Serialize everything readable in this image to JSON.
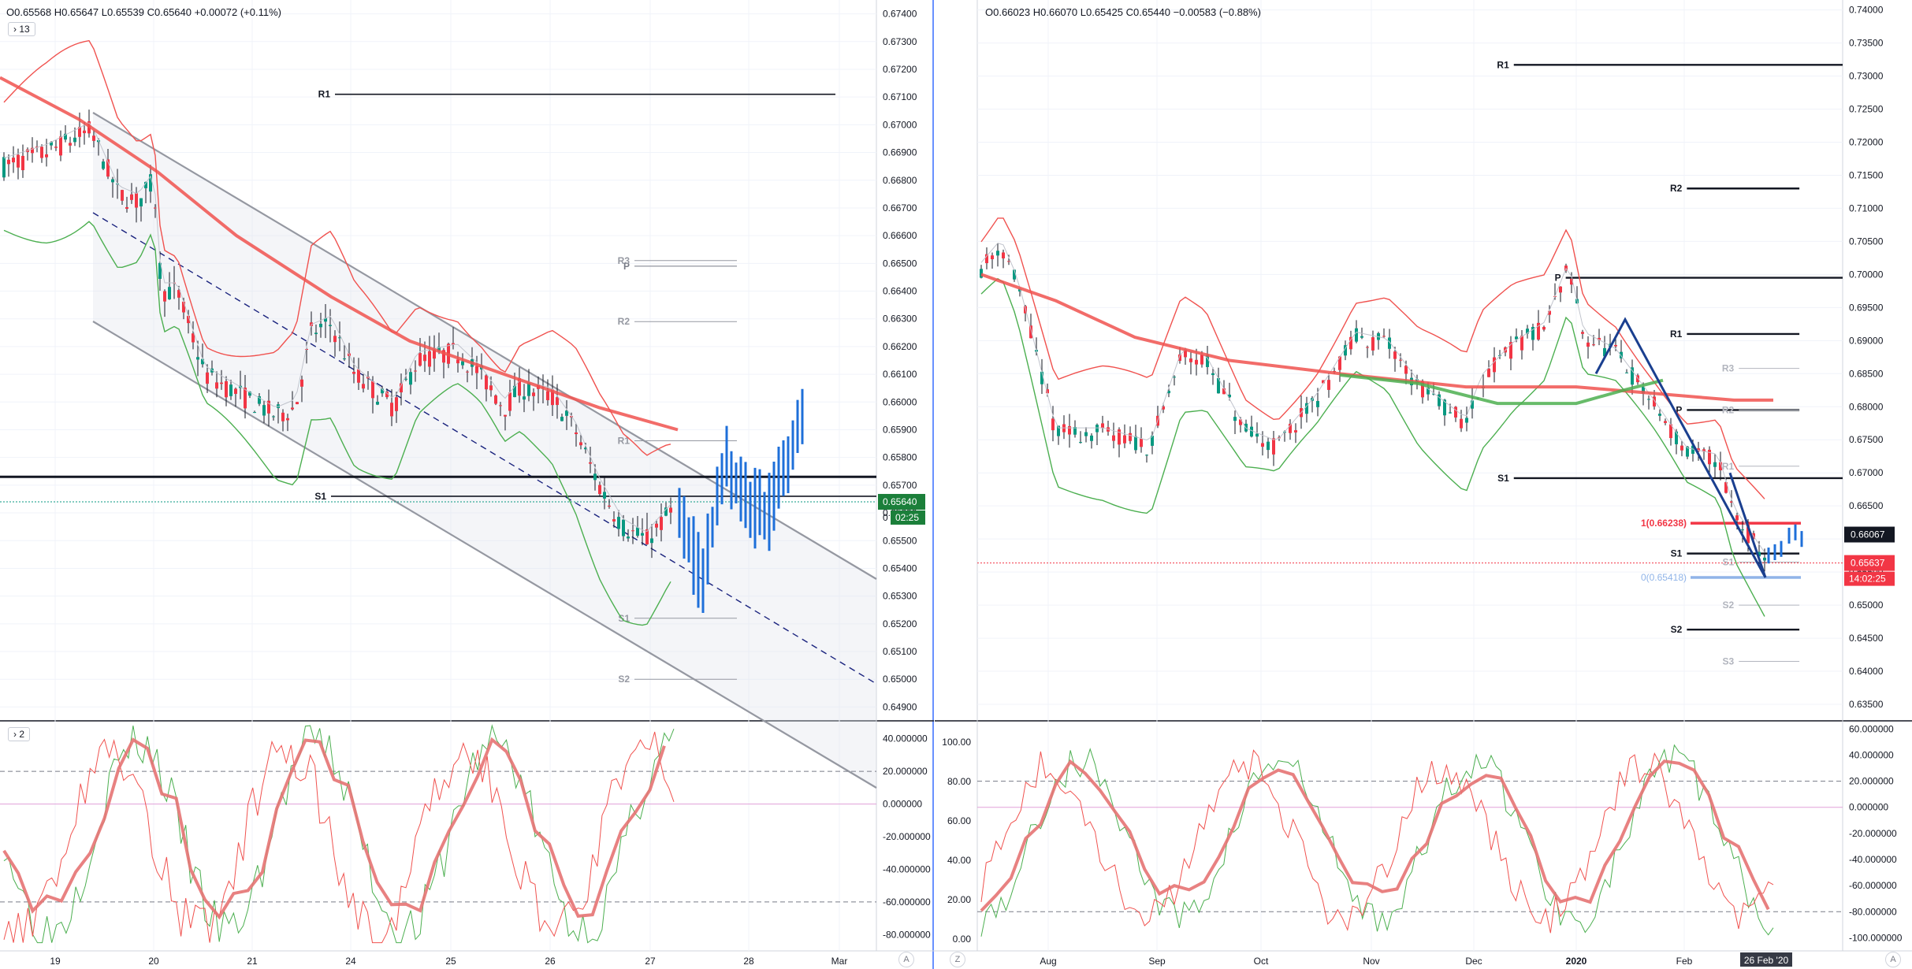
{
  "panes": {
    "left": {
      "ohlc": {
        "o": "O0.65568",
        "h": "H0.65647",
        "l": "L0.65539",
        "c": "C0.65640",
        "chg": "+0.00072 (+0.11%)"
      },
      "indicator_count": "13",
      "osc_count": "2",
      "last_price": "0.65640",
      "countdown": "02:25",
      "timer_digit": "0"
    },
    "right": {
      "ohlc": {
        "o": "O0.66023",
        "h": "H0.66070",
        "l": "L0.65425",
        "c": "C0.65440",
        "chg": "−0.00583 (−0.88%)"
      },
      "price_label_a": "0.66067",
      "price_label_b": "0.65637",
      "countdown": "14:02:25",
      "date_label": "26 Feb '20",
      "fib_1": "1(0.66238)",
      "fib_0": "0(0.65418)"
    },
    "corner_z": "Z",
    "corner_a": "A"
  },
  "chart_data": [
    {
      "type": "candlestick",
      "pane": "left-main",
      "x_ticks": [
        "19",
        "20",
        "21",
        "24",
        "25",
        "26",
        "27",
        "28",
        "Mar"
      ],
      "y_ticks": [
        "0.67400",
        "0.67300",
        "0.67200",
        "0.67100",
        "0.67000",
        "0.66900",
        "0.66800",
        "0.66700",
        "0.66600",
        "0.66500",
        "0.66400",
        "0.66300",
        "0.66200",
        "0.66100",
        "0.66000",
        "0.65900",
        "0.65800",
        "0.65700",
        "0.65600",
        "0.65500",
        "0.65400",
        "0.65300",
        "0.65200",
        "0.65100",
        "0.65000",
        "0.64900"
      ],
      "ylim": [
        0.6485,
        0.6745
      ],
      "pivot_labels": [
        "R1",
        "P",
        "R3",
        "R2",
        "R1",
        "S1",
        "S1",
        "S2"
      ],
      "pivots": [
        {
          "label": "R1",
          "value": 0.6711,
          "color": "#131722"
        },
        {
          "label": "P",
          "value": 0.6649,
          "color": "#787b86"
        },
        {
          "label": "R3",
          "value": 0.6651,
          "color": "#9598a1"
        },
        {
          "label": "R2",
          "value": 0.6629,
          "color": "#9598a1"
        },
        {
          "label": "R1",
          "value": 0.6586,
          "color": "#9598a1"
        },
        {
          "label": "S1",
          "value": 0.6566,
          "color": "#131722"
        },
        {
          "label": "S1",
          "value": 0.6522,
          "color": "#9598a1"
        },
        {
          "label": "S2",
          "value": 0.65,
          "color": "#9598a1"
        }
      ],
      "black_level": 0.6573,
      "current": 0.6564,
      "colors": {
        "up": "#089981",
        "down": "#f23645",
        "blue": "#1e6fd9",
        "ma": "#f0524f",
        "bb_upper": "#f0524f",
        "bb_lower": "#4caf50",
        "channel": "#9598a1"
      }
    },
    {
      "type": "line",
      "pane": "left-oscillator",
      "y_ticks": [
        "40.000000",
        "20.000000",
        "0.000000",
        "-20.000000",
        "-40.000000",
        "-60.000000",
        "-80.000000"
      ],
      "ylim": [
        -90,
        50
      ],
      "levels": [
        20,
        -60
      ],
      "zero": 0
    },
    {
      "type": "candlestick",
      "pane": "right-main",
      "x_ticks": [
        "Aug",
        "Sep",
        "Oct",
        "Nov",
        "Dec",
        "2020",
        "Feb"
      ],
      "y_ticks": [
        "0.74000",
        "0.73500",
        "0.73000",
        "0.72500",
        "0.72000",
        "0.71500",
        "0.71000",
        "0.70500",
        "0.70000",
        "0.69500",
        "0.69000",
        "0.68500",
        "0.68000",
        "0.67500",
        "0.67000",
        "0.66500",
        "0.66000",
        "0.65500",
        "0.65000",
        "0.64500",
        "0.64000",
        "0.63500"
      ],
      "ylim": [
        0.6325,
        0.7415
      ],
      "pivot_labels": [
        "R1",
        "R2",
        "P",
        "R1",
        "R3",
        "R2",
        "S1",
        "R1",
        "S1",
        "S1",
        "S2",
        "S2",
        "S3"
      ],
      "pivots": [
        {
          "label": "R1",
          "value": 0.7317,
          "color": "#131722",
          "x0": 0.62,
          "x1": 1.0
        },
        {
          "label": "R2",
          "value": 0.713,
          "color": "#131722",
          "x0": 0.82,
          "x1": 0.95
        },
        {
          "label": "P",
          "value": 0.6995,
          "color": "#131722",
          "x0": 0.68,
          "x1": 1.0
        },
        {
          "label": "R1",
          "value": 0.691,
          "color": "#131722",
          "x0": 0.82,
          "x1": 0.95
        },
        {
          "label": "R3",
          "value": 0.6858,
          "color": "#b2b5be",
          "x0": 0.88,
          "x1": 0.95
        },
        {
          "label": "P",
          "value": 0.6795,
          "color": "#131722",
          "x0": 0.82,
          "x1": 0.95
        },
        {
          "label": "R2",
          "value": 0.6795,
          "color": "#b2b5be",
          "x0": 0.88,
          "x1": 0.95
        },
        {
          "label": "S1",
          "value": 0.6692,
          "color": "#131722",
          "x0": 0.62,
          "x1": 1.0
        },
        {
          "label": "R1",
          "value": 0.671,
          "color": "#b2b5be",
          "x0": 0.88,
          "x1": 0.95
        },
        {
          "label": "S1",
          "value": 0.6578,
          "color": "#131722",
          "x0": 0.82,
          "x1": 0.95
        },
        {
          "label": "S1",
          "value": 0.6565,
          "color": "#b2b5be",
          "x0": 0.88,
          "x1": 0.95
        },
        {
          "label": "S2",
          "value": 0.65,
          "color": "#b2b5be",
          "x0": 0.88,
          "x1": 0.95
        },
        {
          "label": "S2",
          "value": 0.6463,
          "color": "#131722",
          "x0": 0.82,
          "x1": 0.95
        },
        {
          "label": "S3",
          "value": 0.6415,
          "color": "#b2b5be",
          "x0": 0.88,
          "x1": 0.95
        }
      ],
      "fib": [
        {
          "label": "1(0.66238)",
          "value": 0.66238,
          "color": "#f23645"
        },
        {
          "label": "0(0.65418)",
          "value": 0.65418,
          "color": "#90b4e8"
        }
      ],
      "colors": {
        "up": "#089981",
        "down": "#f23645",
        "blue": "#1e6fd9",
        "ma_red": "#f0524f",
        "ma_green": "#4caf50",
        "bb_upper": "#f0524f",
        "bb_lower": "#4caf50",
        "trend": "#1a3f8f"
      }
    },
    {
      "type": "line",
      "pane": "right-oscillator",
      "y_ticks_left": [
        "100.00",
        "80.00",
        "60.00",
        "40.00",
        "20.00",
        "0.00"
      ],
      "y_ticks_right": [
        "60.000000",
        "40.000000",
        "20.000000",
        "0.000000",
        "-20.000000",
        "-40.000000",
        "-60.000000",
        "-80.000000",
        "-100.000000"
      ],
      "ylim": [
        -110,
        65
      ],
      "levels": [
        20,
        -80
      ],
      "zero": 0
    }
  ]
}
